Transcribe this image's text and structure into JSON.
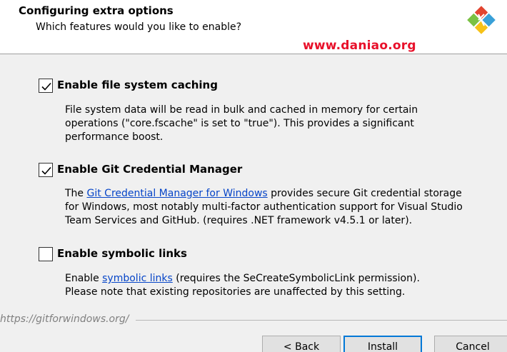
{
  "header": {
    "title": "Configuring extra options",
    "subtitle": "Which features would you like to enable?",
    "watermark": "www.daniao.org"
  },
  "options": [
    {
      "label": "Enable file system caching",
      "checked": true,
      "desc_lines": [
        "File system data will be read in bulk and cached in memory for certain",
        "operations (\"core.fscache\" is set to \"true\"). This provides a significant",
        "performance boost."
      ]
    },
    {
      "label": "Enable Git Credential Manager",
      "checked": true,
      "desc_prefix": "The ",
      "desc_link": "Git Credential Manager for Windows",
      "desc_suffix": " provides secure Git credential storage",
      "desc_lines": [
        "for Windows, most notably multi-factor authentication support for Visual Studio",
        "Team Services and GitHub. (requires .NET framework v4.5.1 or later)."
      ]
    },
    {
      "label": "Enable symbolic links",
      "checked": false,
      "desc_prefix": "Enable ",
      "desc_link": "symbolic links",
      "desc_suffix": " (requires the SeCreateSymbolicLink permission).",
      "desc_lines": [
        "Please note that existing repositories are unaffected by this setting."
      ]
    }
  ],
  "footer": {
    "url": "https://gitforwindows.org/"
  },
  "buttons": {
    "back": "< Back",
    "install": "Install",
    "cancel": "Cancel"
  },
  "colors": {
    "link": "#0645c8",
    "watermark": "#e8102a",
    "primary_border": "#0078d7"
  }
}
